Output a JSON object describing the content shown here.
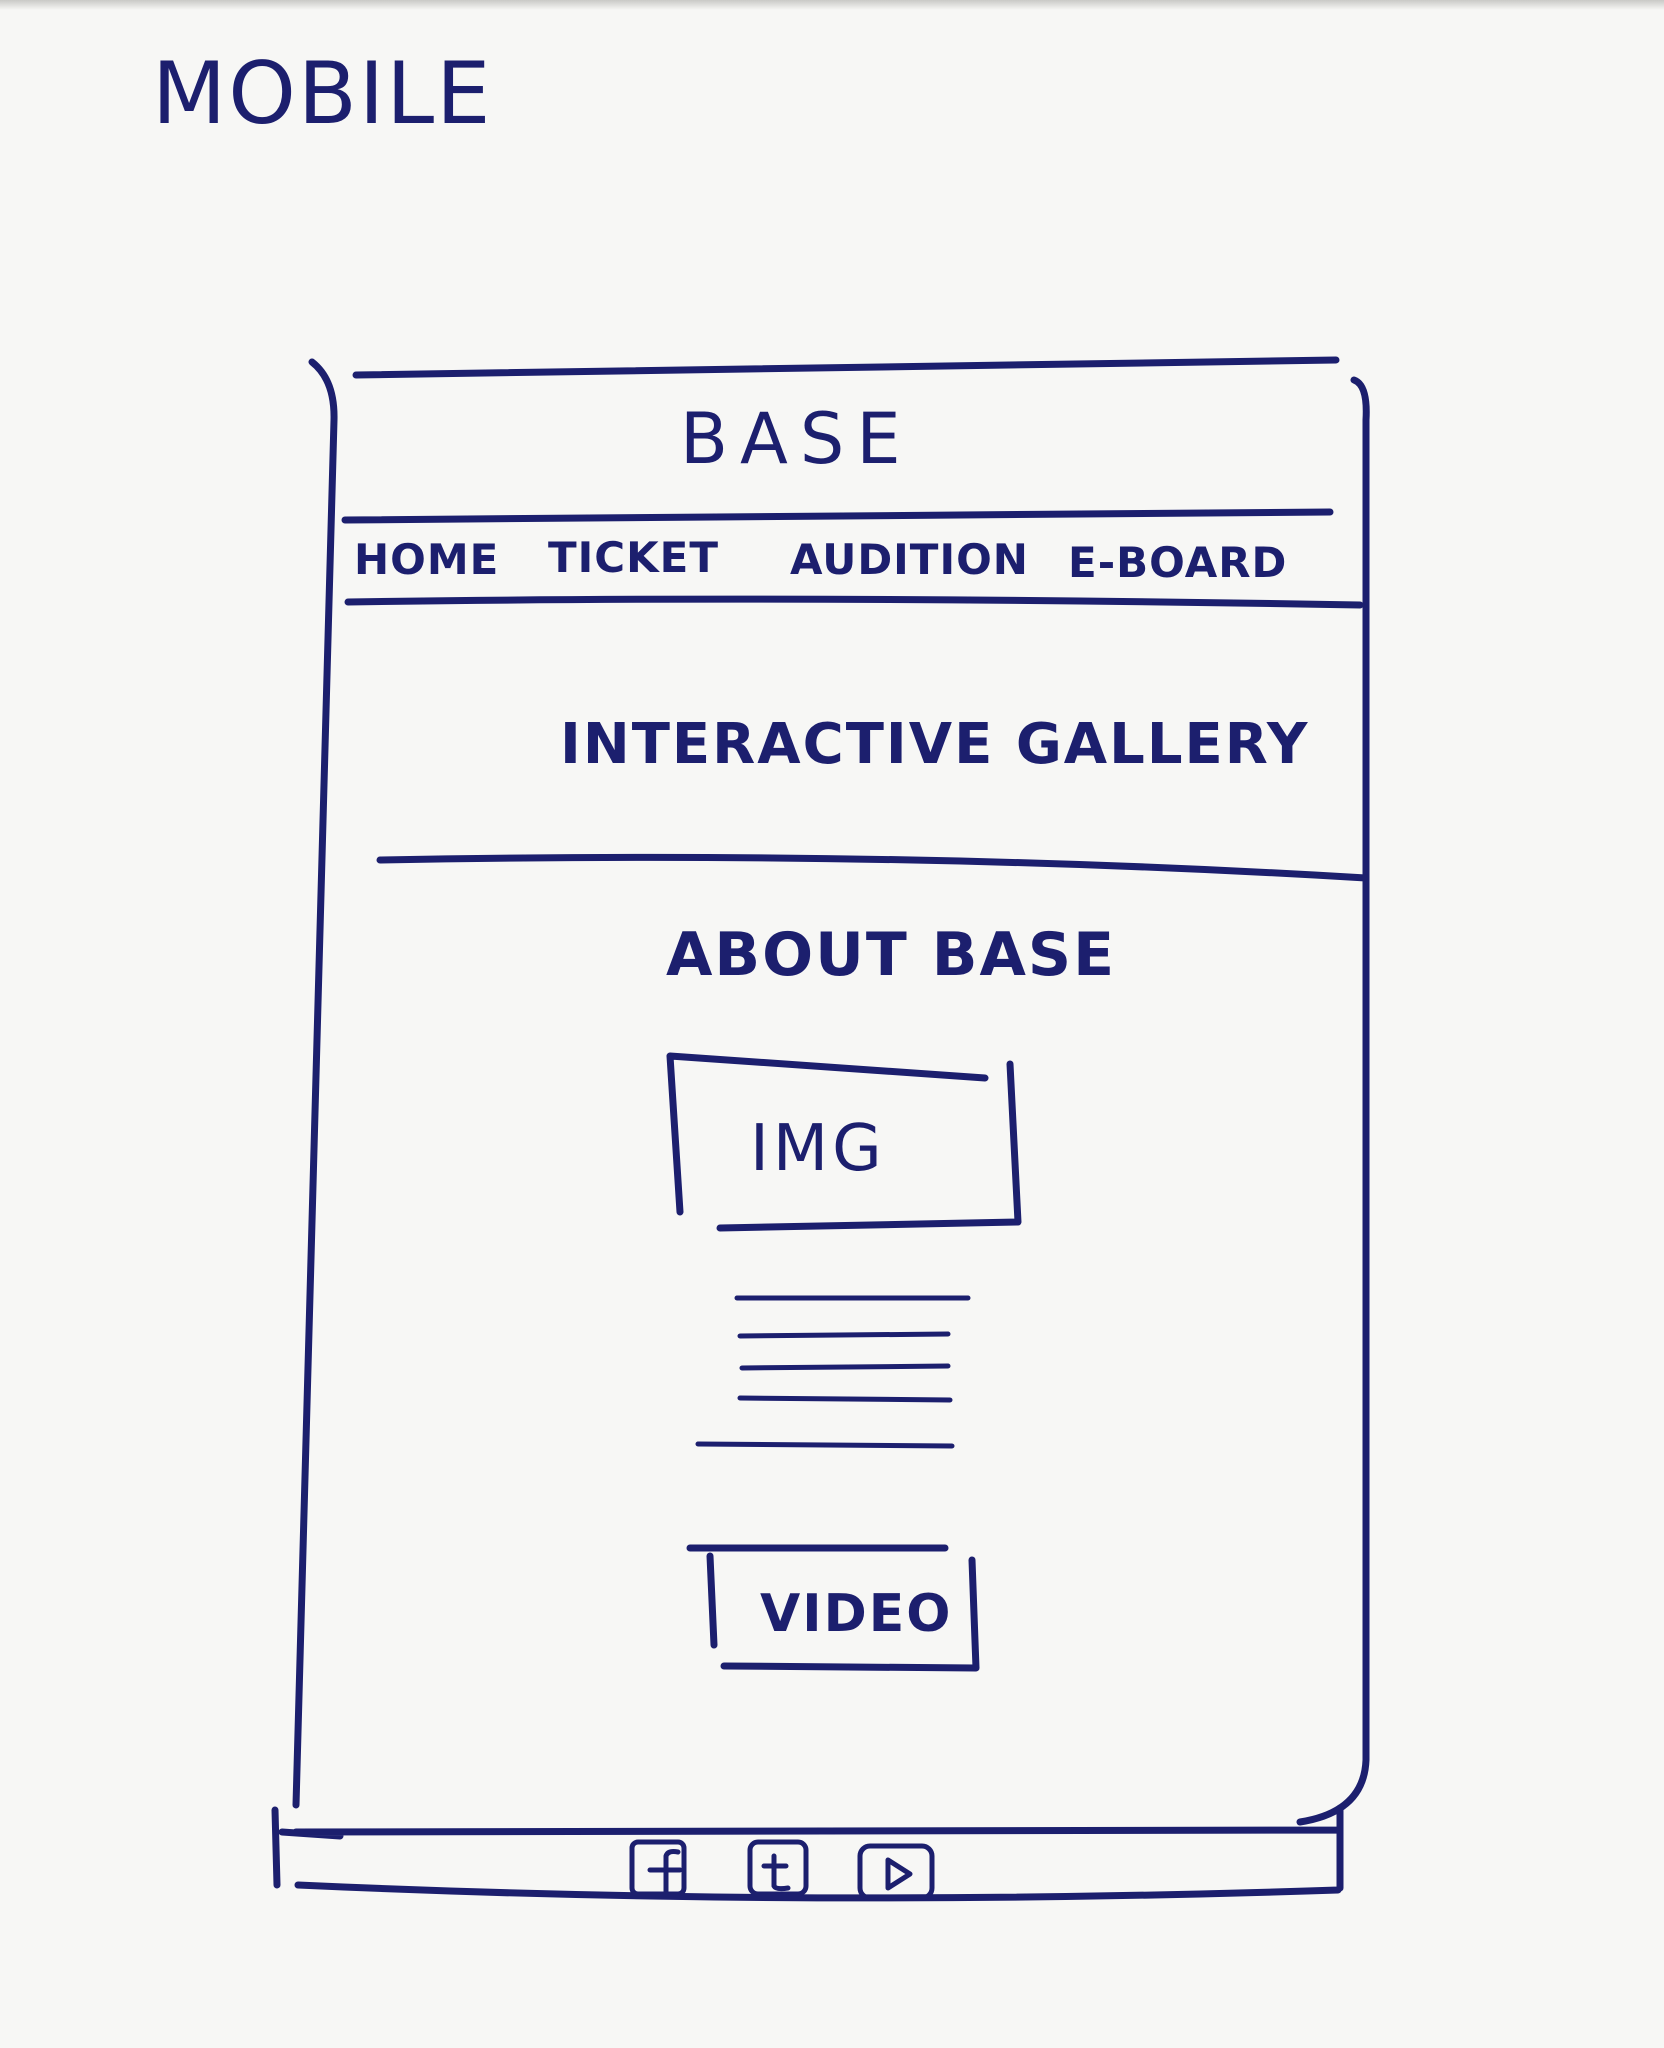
{
  "sheet_title": "MOBILE",
  "app": {
    "title": "BASE",
    "nav": [
      "HOME",
      "TICKET",
      "AUDITION",
      "E-BOARD"
    ],
    "hero": "INTERACTIVE GALLERY",
    "section_heading": "ABOUT BASE",
    "image_placeholder": "IMG",
    "video_placeholder": "VIDEO"
  },
  "footer_icons": [
    "facebook-icon",
    "tumblr-icon",
    "youtube-icon"
  ],
  "colors": {
    "ink": "#1c1f6e",
    "paper": "#f7f7f5"
  }
}
